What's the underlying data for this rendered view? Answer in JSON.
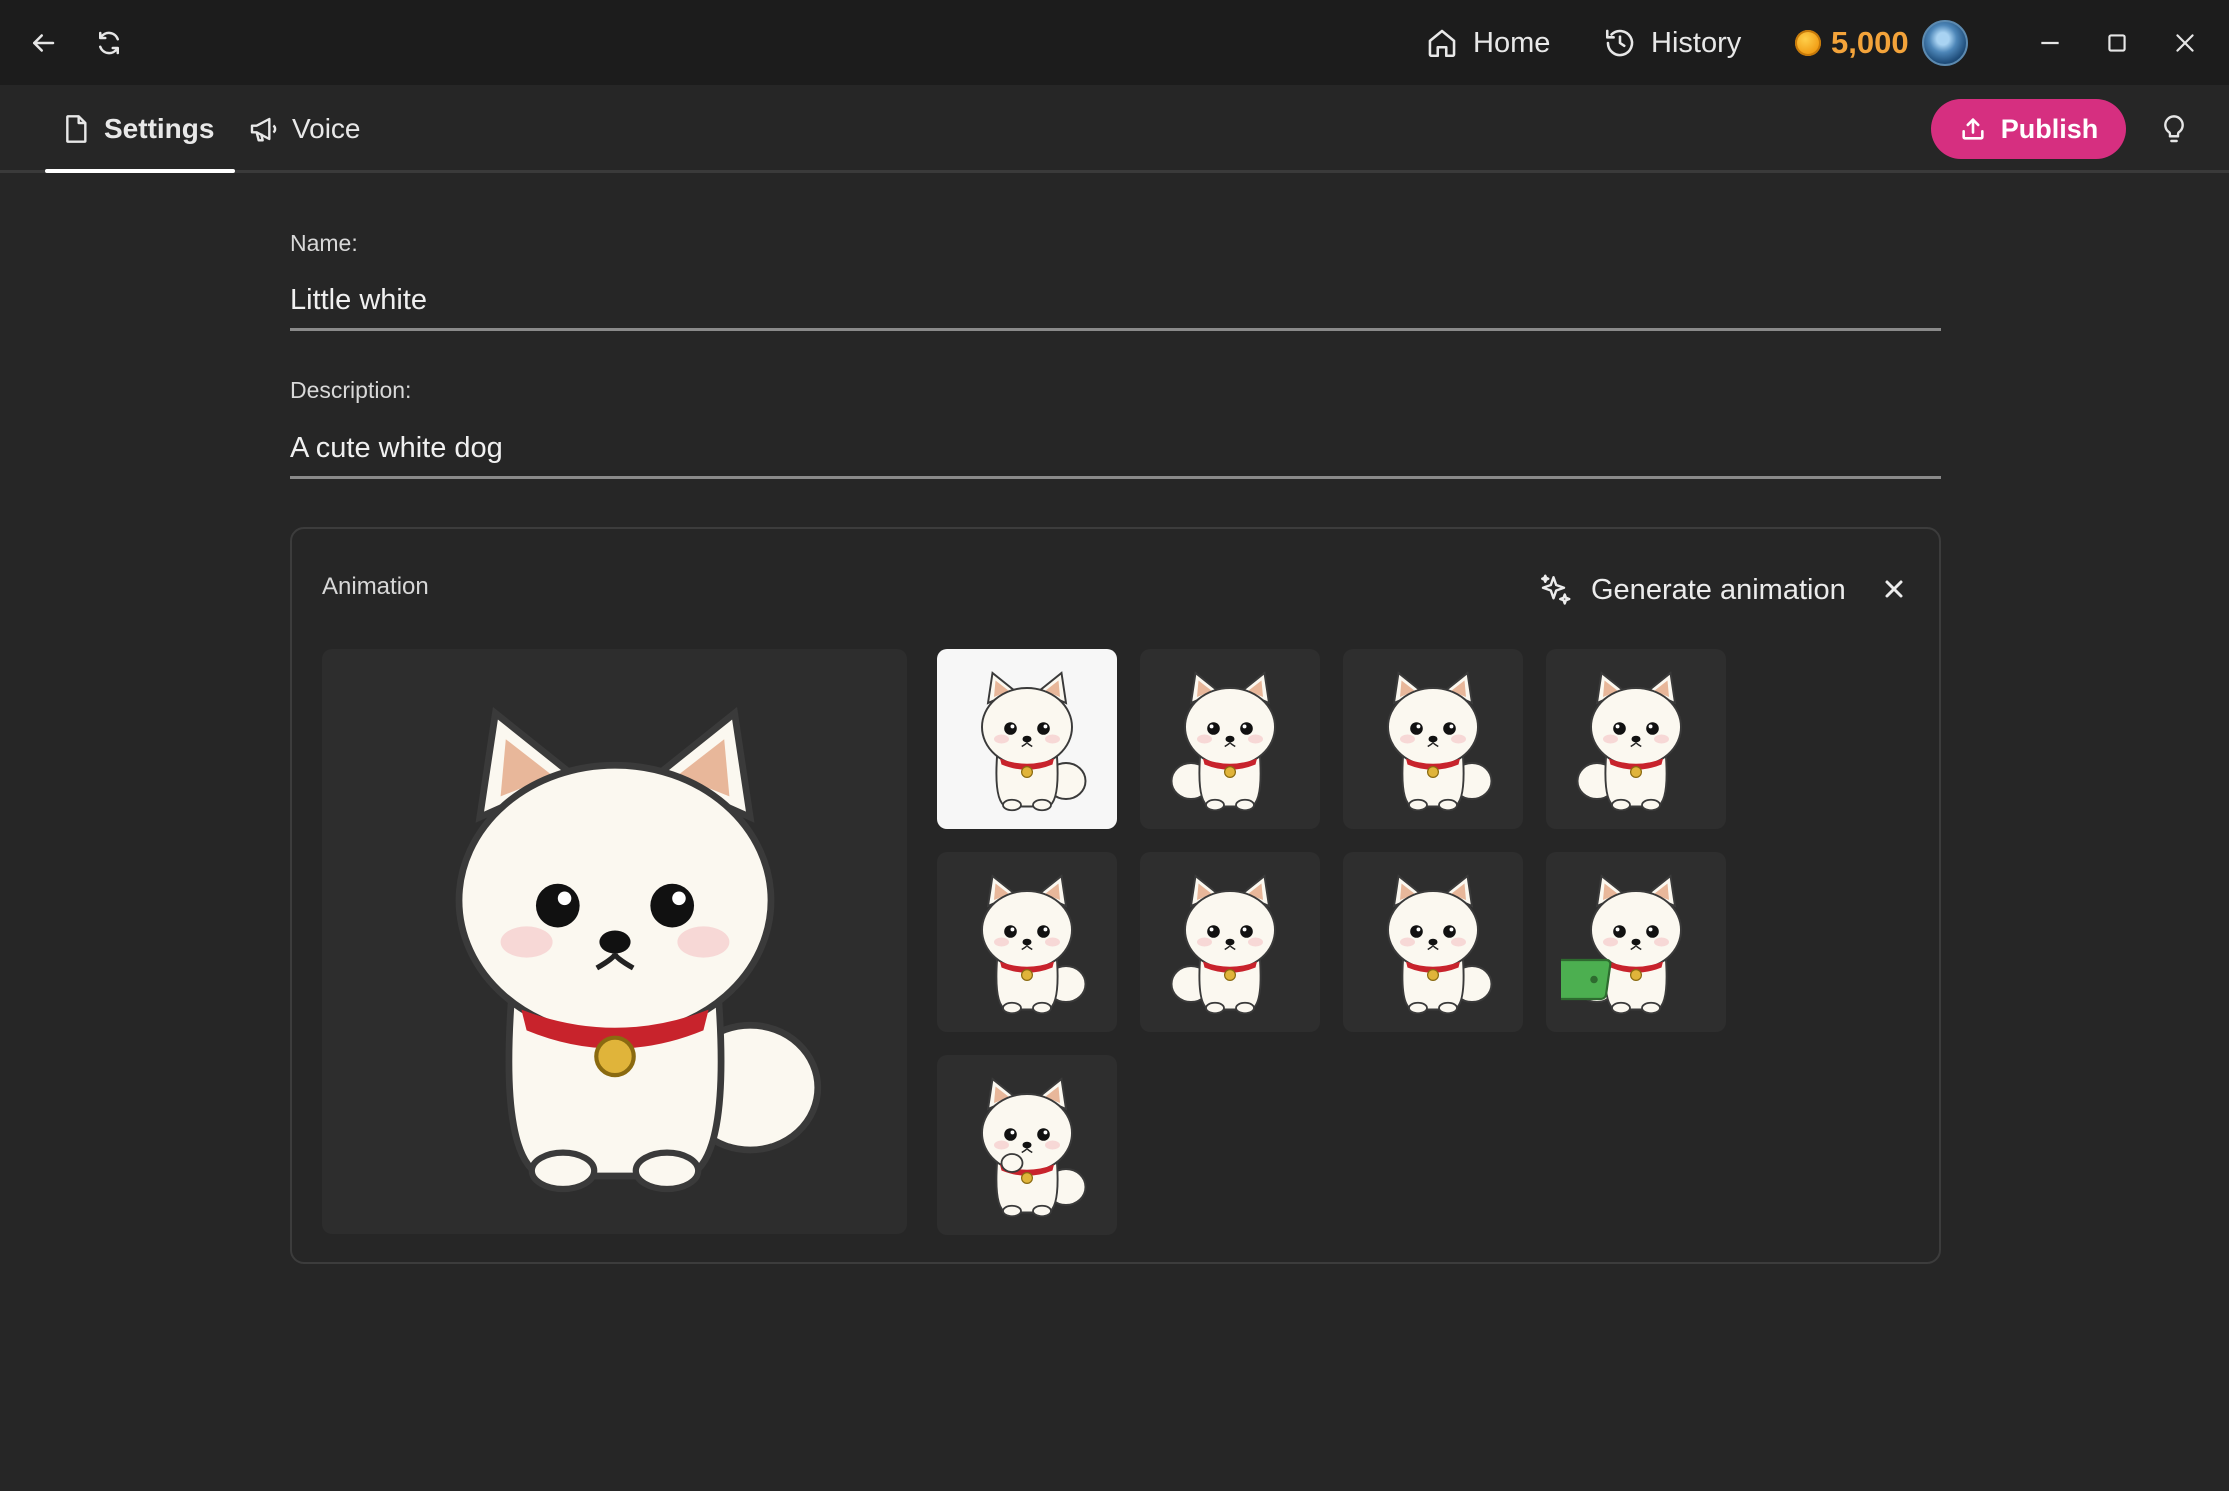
{
  "titlebar": {
    "home_label": "Home",
    "history_label": "History",
    "coins": "5,000"
  },
  "tabs": {
    "settings_label": "Settings",
    "voice_label": "Voice"
  },
  "toolbar": {
    "publish_label": "Publish"
  },
  "form": {
    "name_label": "Name:",
    "name_value": "Little white",
    "description_label": "Description:",
    "description_value": "A cute white dog"
  },
  "animation": {
    "title": "Animation",
    "generate_label": "Generate animation",
    "thumbnail_count": 9,
    "selected_index": 0
  },
  "colors": {
    "accent": "#d62f80",
    "coin": "#f3a33a",
    "background": "#262626",
    "titlebar": "#1c1c1c"
  },
  "icons": [
    "back-arrow-icon",
    "refresh-icon",
    "home-icon",
    "history-icon",
    "coin-icon",
    "avatar",
    "minimize-icon",
    "maximize-icon",
    "close-icon",
    "document-icon",
    "megaphone-icon",
    "upload-icon",
    "lightbulb-icon",
    "sparkle-icon"
  ]
}
